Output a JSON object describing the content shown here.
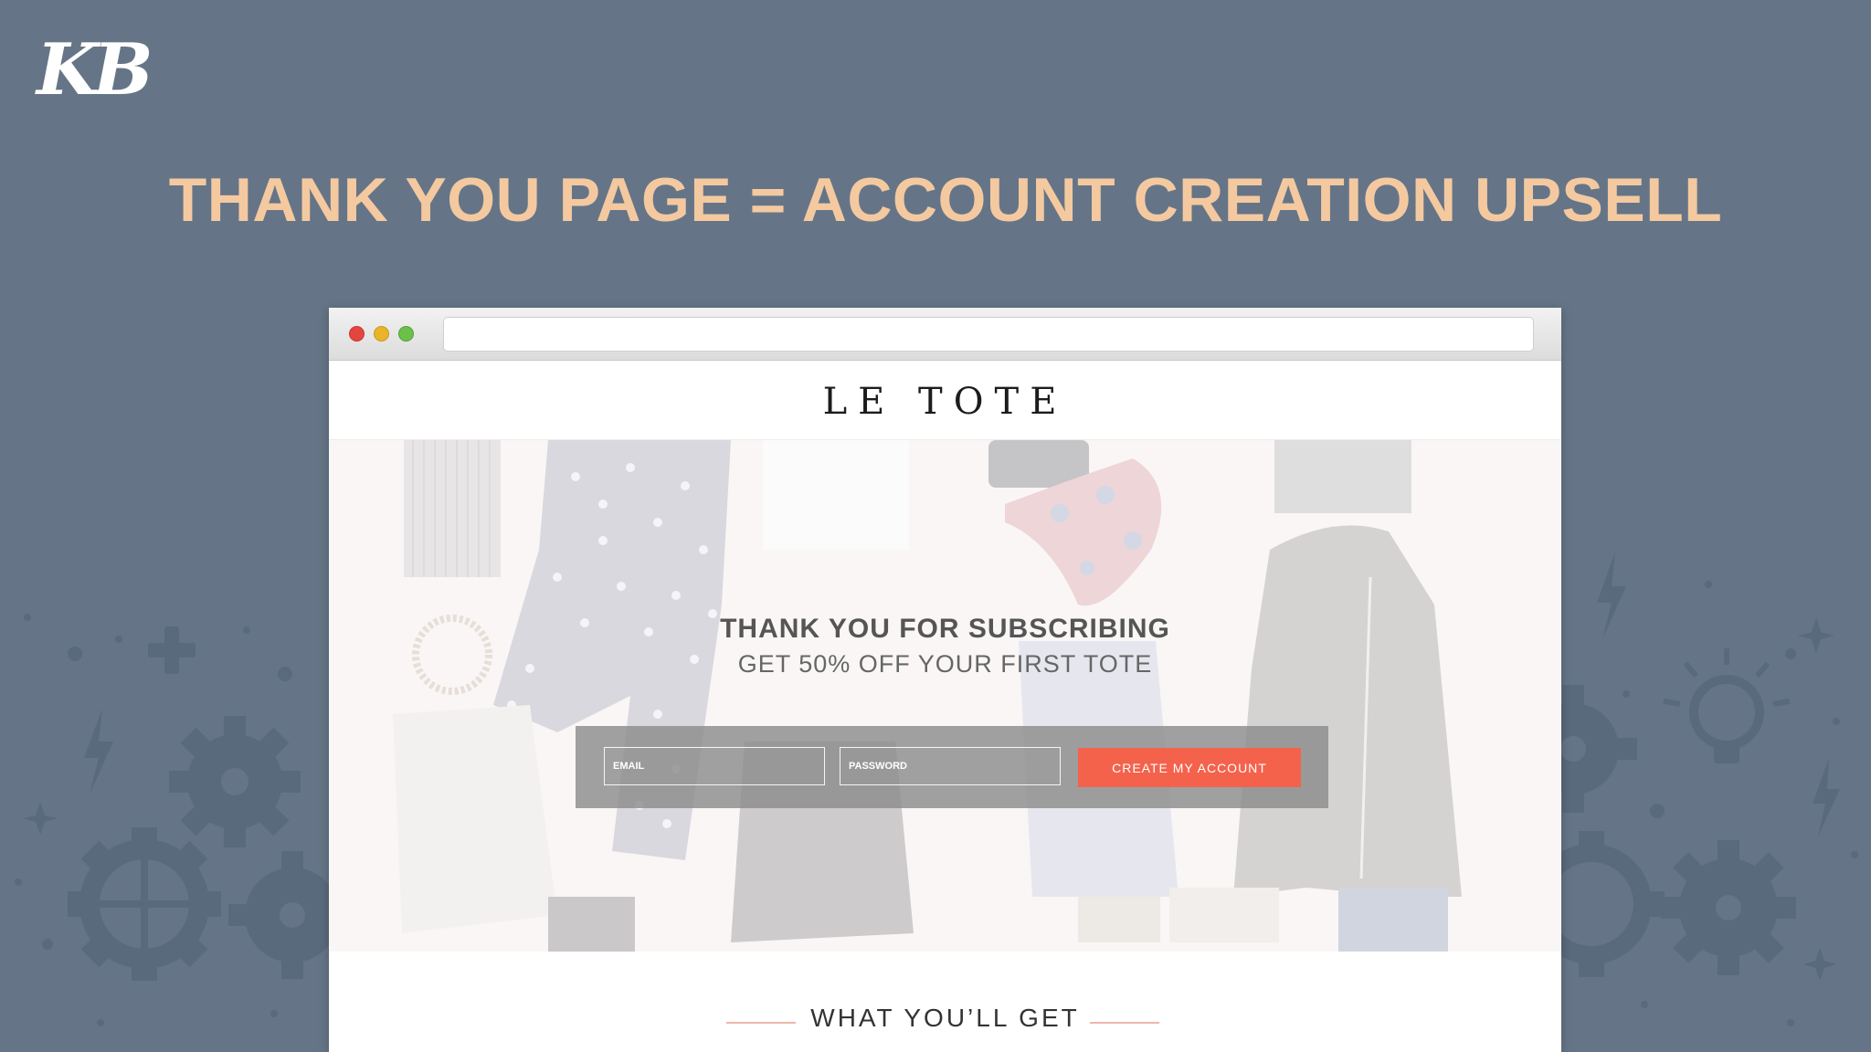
{
  "slide": {
    "logo_text": "KB",
    "headline": "THANK YOU PAGE = ACCOUNT CREATION UPSELL"
  },
  "browser": {
    "address_value": ""
  },
  "site": {
    "brand": "LE TOTE",
    "hero": {
      "title": "THANK YOU FOR SUBSCRIBING",
      "subtitle": "GET 50% OFF YOUR FIRST TOTE"
    },
    "form": {
      "email_placeholder": "EMAIL",
      "password_placeholder": "PASSWORD",
      "submit_label": "CREATE MY ACCOUNT"
    },
    "section_title": "WHAT YOU’LL GET"
  },
  "colors": {
    "background": "#657587",
    "headline": "#f4c9a0",
    "cta": "#f4624b"
  }
}
